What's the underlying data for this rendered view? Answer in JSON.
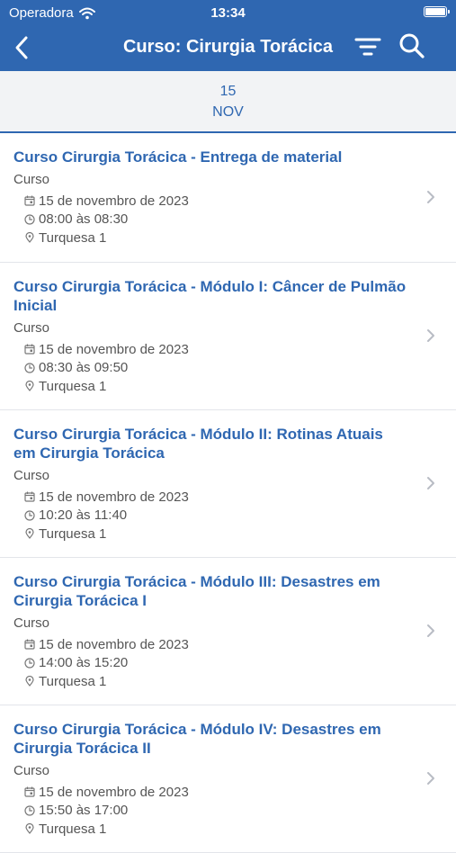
{
  "status_bar": {
    "carrier": "Operadora",
    "time": "13:34"
  },
  "header": {
    "title": "Curso: Cirurgia Torácica"
  },
  "date_selector": {
    "day": "15",
    "month": "NOV"
  },
  "events": [
    {
      "title": "Curso Cirurgia Torácica - Entrega de material",
      "type": "Curso",
      "date": "15 de novembro de 2023",
      "time": "08:00 às 08:30",
      "location": "Turquesa 1"
    },
    {
      "title": "Curso Cirurgia Torácica - Módulo I: Câncer de Pulmão Inicial",
      "type": "Curso",
      "date": "15 de novembro de 2023",
      "time": "08:30 às 09:50",
      "location": "Turquesa 1"
    },
    {
      "title": "Curso Cirurgia Torácica - Módulo II: Rotinas Atuais em Cirurgia Torácica",
      "type": "Curso",
      "date": "15 de novembro de 2023",
      "time": "10:20 às 11:40",
      "location": "Turquesa 1"
    },
    {
      "title": "Curso Cirurgia Torácica - Módulo III: Desastres em Cirurgia Torácica I",
      "type": "Curso",
      "date": "15 de novembro de 2023",
      "time": "14:00 às 15:20",
      "location": "Turquesa 1"
    },
    {
      "title": "Curso Cirurgia Torácica - Módulo IV: Desastres em Cirurgia Torácica II",
      "type": "Curso",
      "date": "15 de novembro de 2023",
      "time": "15:50 às 17:00",
      "location": "Turquesa 1"
    }
  ],
  "colors": {
    "primary": "#2f67b1",
    "date_bar_bg": "#f2f3f5",
    "meta_text": "#555555"
  },
  "icons": {
    "back": "chevron-left-icon",
    "filter": "filter-icon",
    "search": "search-icon",
    "calendar": "calendar-icon",
    "clock": "clock-icon",
    "location": "map-pin-icon",
    "row": "chevron-right-icon"
  }
}
